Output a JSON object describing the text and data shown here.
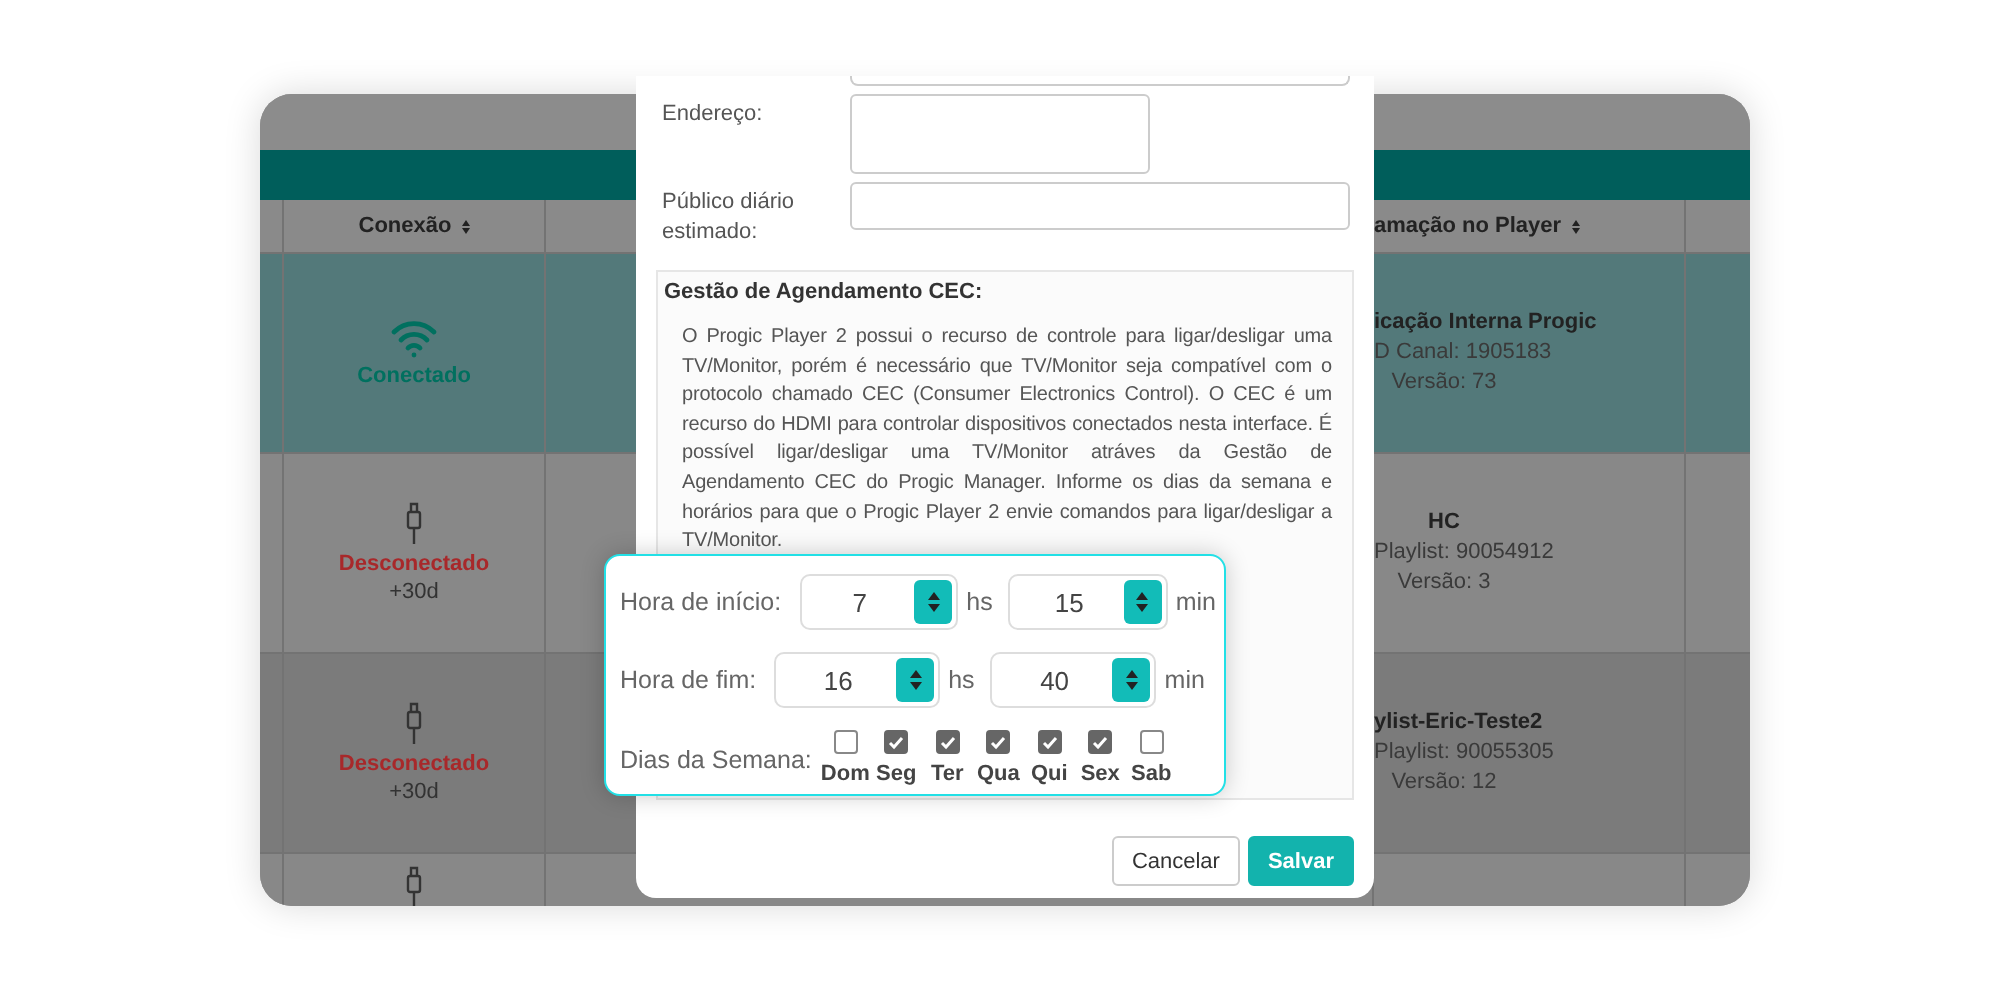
{
  "table": {
    "columns": [
      "Conexão",
      "amação no Player"
    ],
    "rows": [
      {
        "selected": true,
        "connection": {
          "connected": true,
          "status": "Conectado"
        },
        "program": [
          {
            "text": "icação Interna Progic",
            "bold": true
          },
          {
            "text": "D Canal: 1905183",
            "bold": false
          },
          {
            "text": "Versão: 73",
            "bold": false
          }
        ]
      },
      {
        "selected": false,
        "connection": {
          "connected": false,
          "status": "Desconectado",
          "since": "+30d"
        },
        "program": [
          {
            "text": "HC",
            "bold": true
          },
          {
            "text": "Playlist: 90054912",
            "bold": false
          },
          {
            "text": "Versão: 3",
            "bold": false
          }
        ]
      },
      {
        "selected": false,
        "connection": {
          "connected": false,
          "status": "Desconectado",
          "since": "+30d"
        },
        "program": [
          {
            "text": "ylist-Eric-Teste2",
            "bold": true
          },
          {
            "text": "Playlist: 90055305",
            "bold": false
          },
          {
            "text": "Versão: 12",
            "bold": false
          }
        ]
      },
      {
        "selected": false,
        "connection": {
          "connected": false
        }
      }
    ]
  },
  "modal": {
    "fields": [
      {
        "label": "Endereço:",
        "kind": "textarea"
      },
      {
        "label": "Público diário estimado:",
        "kind": "input"
      }
    ],
    "cec": {
      "title": "Gestão de Agendamento CEC:",
      "text": "O Progic Player 2 possui o recurso de controle para ligar/desligar uma TV/Monitor, porém é necessário que TV/Monitor seja compatível com o protocolo chamado CEC (Consumer Electronics Control). O CEC é um recurso do HDMI para controlar dispositivos conectados nesta interface. É possível ligar/desligar uma TV/Monitor atráves da Gestão de Agendamento CEC do Progic Manager. Informe os dias da semana e horários para que o Progic Player 2 envie comandos para ligar/desligar a TV/Monitor."
    },
    "buttons": [
      {
        "label": "Cancelar",
        "kind": "secondary"
      },
      {
        "label": "Salvar",
        "kind": "primary"
      }
    ]
  },
  "schedule": {
    "times": [
      {
        "label": "Hora de início:",
        "hours": "7",
        "hours_unit": "hs",
        "minutes": "15",
        "minutes_unit": "min"
      },
      {
        "label": "Hora de fim:",
        "hours": "16",
        "hours_unit": "hs",
        "minutes": "40",
        "minutes_unit": "min"
      }
    ],
    "days_label": "Dias da Semana:",
    "days": [
      {
        "label": "Dom",
        "checked": false
      },
      {
        "label": "Seg",
        "checked": true
      },
      {
        "label": "Ter",
        "checked": true
      },
      {
        "label": "Qua",
        "checked": true
      },
      {
        "label": "Qui",
        "checked": true
      },
      {
        "label": "Sex",
        "checked": true
      },
      {
        "label": "Sab",
        "checked": false
      }
    ]
  }
}
